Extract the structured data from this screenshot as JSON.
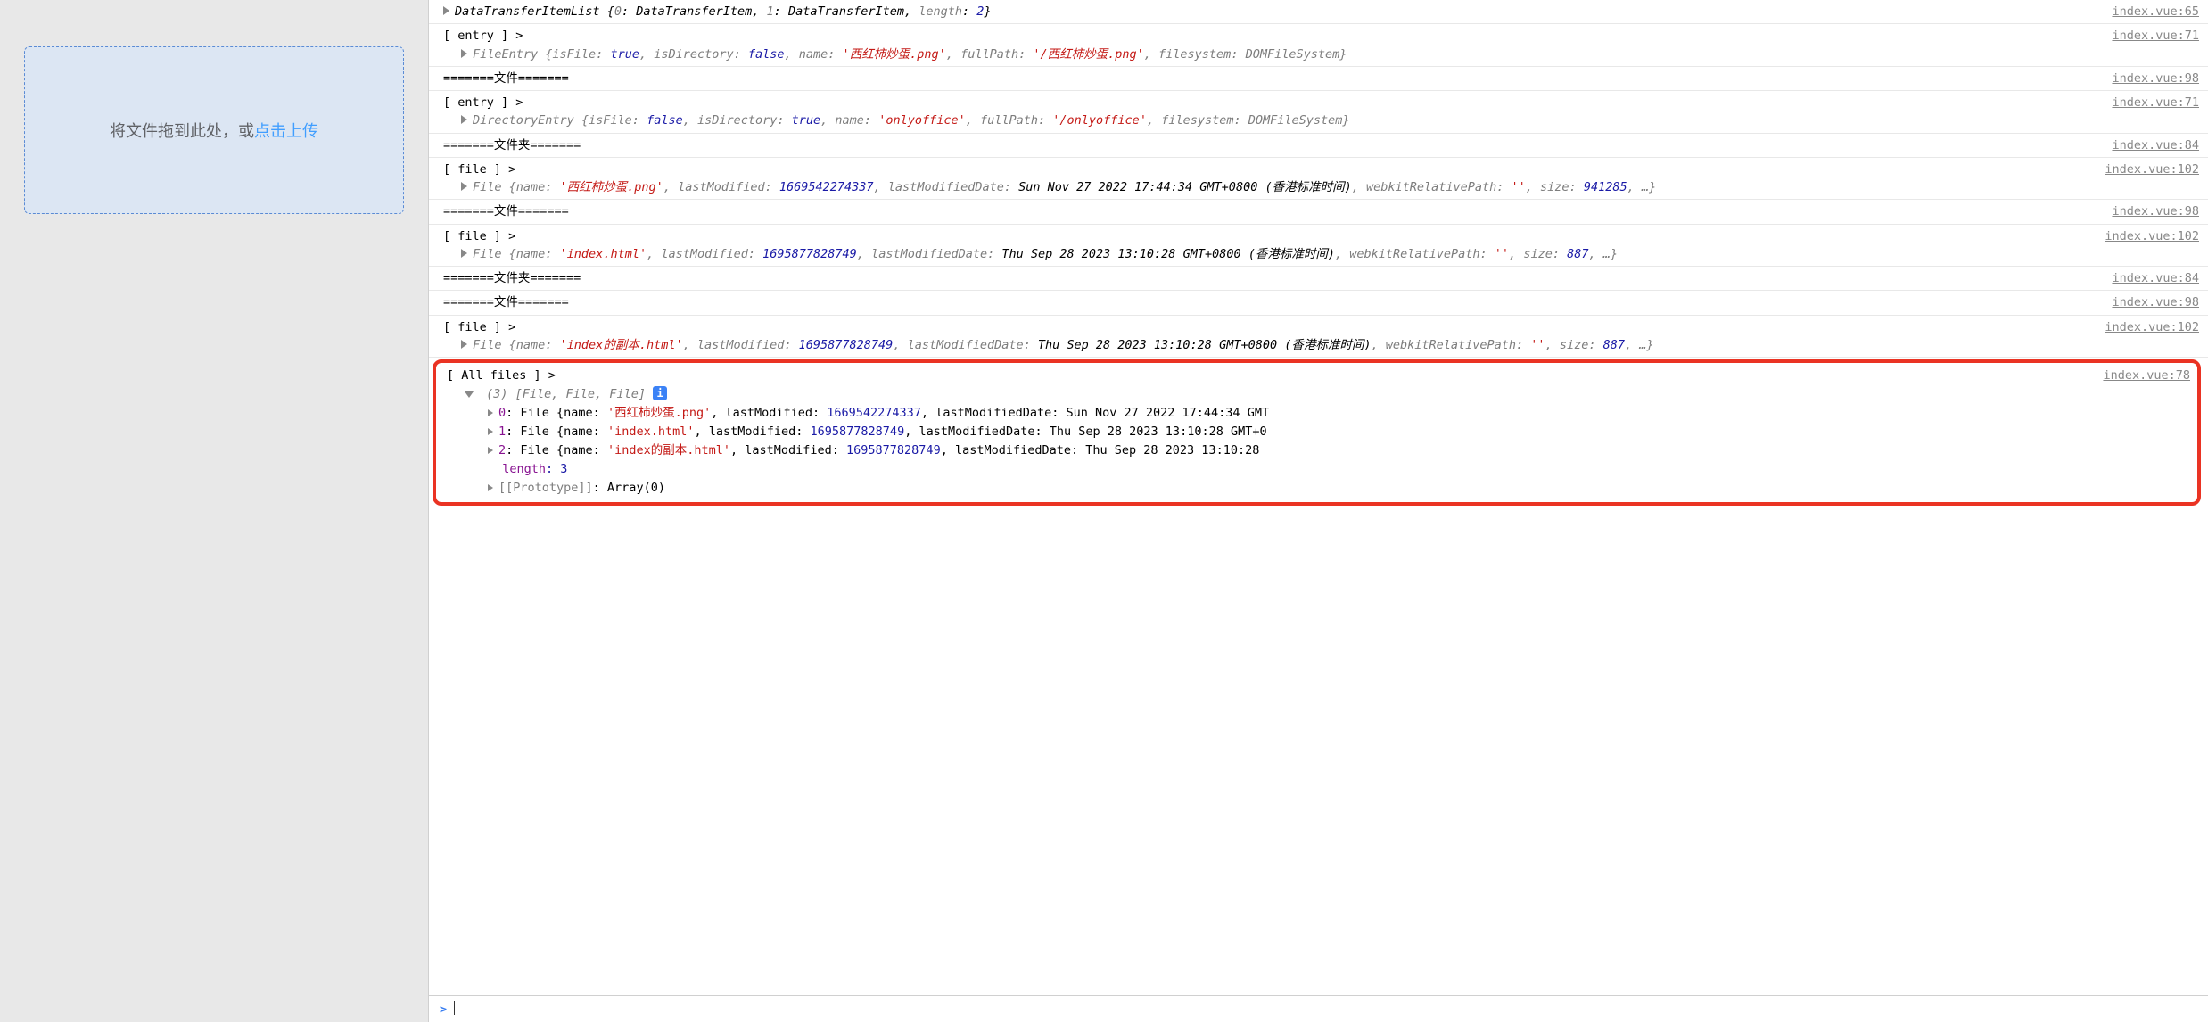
{
  "dropzone": {
    "text1": "将文件拖到此处，或",
    "link": "点击上传"
  },
  "logs": {
    "r1": {
      "src": "index.vue:65",
      "body": "DataTransferItemList {0: DataTransferItem, 1: DataTransferItem, length: 2}"
    },
    "r2": {
      "src": "index.vue:71",
      "tag": "[ entry ] >",
      "pre": "FileEntry {isFile: ",
      "v1": "true",
      "m1": ", isDirectory: ",
      "v2": "false",
      "m2": ", name: ",
      "s1": "'西红柿炒蛋.png'",
      "m3": ", fullPath: ",
      "s2": "'/西红柿炒蛋.png'",
      "m4": ", filesystem: DOMFileSystem}"
    },
    "r3": {
      "src": "index.vue:98",
      "txt": "=======文件======="
    },
    "r4": {
      "src": "index.vue:71",
      "tag": "[ entry ] >",
      "pre": "DirectoryEntry {isFile: ",
      "v1": "false",
      "m1": ", isDirectory: ",
      "v2": "true",
      "m2": ", name: ",
      "s1": "'onlyoffice'",
      "m3": ", fullPath: ",
      "s2": "'/onlyoffice'",
      "m4": ", filesystem: DOMFileSystem}"
    },
    "r5": {
      "src": "index.vue:84",
      "txt": "=======文件夹======="
    },
    "r6": {
      "src": "index.vue:102",
      "tag": "[ file ] >",
      "pre": "File {name: ",
      "s1": "'西红柿炒蛋.png'",
      "m1": ", lastModified: ",
      "v1": "1669542274337",
      "m2": ", lastModifiedDate: ",
      "d1": "Sun Nov 27 2022 17:44:34 GMT+0800 (香港标准时间)",
      "m3": ", webkitRelativePath: ",
      "s2": "''",
      "m4": ", size: ",
      "v2": "941285",
      "m5": ", …}"
    },
    "r7": {
      "src": "index.vue:98",
      "txt": "=======文件======="
    },
    "r8": {
      "src": "index.vue:102",
      "tag": "[ file ] >",
      "pre": "File {name: ",
      "s1": "'index.html'",
      "m1": ", lastModified: ",
      "v1": "1695877828749",
      "m2": ", lastModifiedDate: ",
      "d1": "Thu Sep 28 2023 13:10:28 GMT+0800 (香港标准时间)",
      "m3": ", webkitRelativePath: ",
      "s2": "''",
      "m4": ", size: ",
      "v2": "887",
      "m5": ", …}"
    },
    "r9": {
      "src": "index.vue:84",
      "txt": "=======文件夹======="
    },
    "r10": {
      "src": "index.vue:98",
      "txt": "=======文件======="
    },
    "r11": {
      "src": "index.vue:102",
      "tag": "[ file ] >",
      "pre": "File {name: ",
      "s1": "'index的副本.html'",
      "m1": ", lastModified: ",
      "v1": "1695877828749",
      "m2": ", lastModifiedDate: ",
      "d1": "Thu Sep 28 2023 13:10:28 GMT+0800 (香港标准时间)",
      "m3": ", webkitRelativePath: ",
      "s2": "''",
      "m4": ", size: ",
      "v2": "887",
      "m5": ", …}"
    },
    "box": {
      "src": "index.vue:78",
      "tag": "[ All files ] >",
      "arr": "(3) [File, File, File]",
      "i0k": "0",
      "i0pre": ": File {name: ",
      "i0s": "'西红柿炒蛋.png'",
      "i0m1": ", lastModified: ",
      "i0v": "1669542274337",
      "i0m2": ", lastModifiedDate: ",
      "i0d": "Sun Nov 27 2022 17:44:34 GMT",
      "i1k": "1",
      "i1pre": ": File {name: ",
      "i1s": "'index.html'",
      "i1m1": ", lastModified: ",
      "i1v": "1695877828749",
      "i1m2": ", lastModifiedDate: ",
      "i1d": "Thu Sep 28 2023 13:10:28 GMT+0",
      "i2k": "2",
      "i2pre": ": File {name: ",
      "i2s": "'index的副本.html'",
      "i2m1": ", lastModified: ",
      "i2v": "1695877828749",
      "i2m2": ", lastModifiedDate: ",
      "i2d": "Thu Sep 28 2023 13:10:28",
      "lenk": "length",
      "lenv": ": 3",
      "protok": "[[Prototype]]",
      "protov": ": Array(0)"
    }
  },
  "prompt": {
    "caret": ">"
  }
}
